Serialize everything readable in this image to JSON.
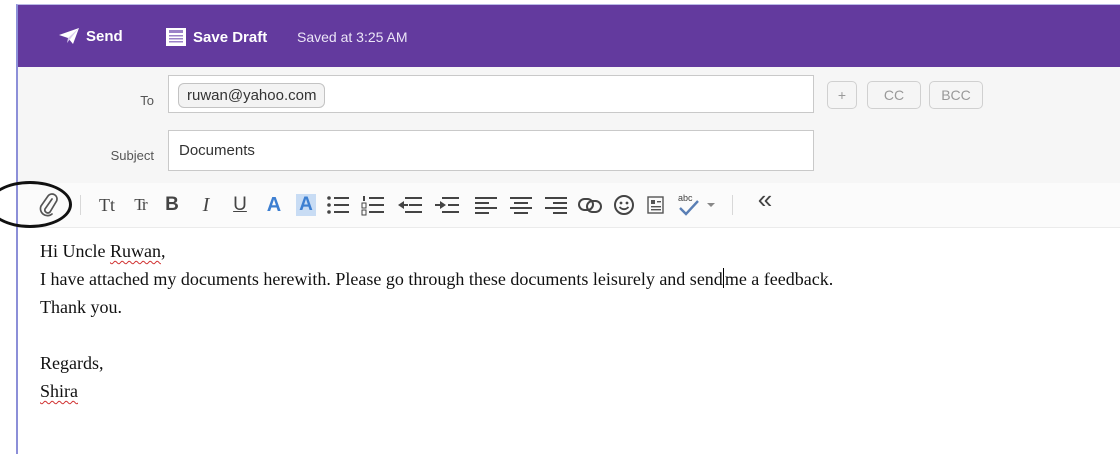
{
  "topbar": {
    "send_label": "Send",
    "save_draft_label": "Save Draft",
    "saved_status": "Saved at 3:25 AM"
  },
  "compose": {
    "to_label": "To",
    "recipients": [
      "ruwan@yahoo.com"
    ],
    "add_recipient": "+",
    "cc_label": "CC",
    "bcc_label": "BCC",
    "subject_label": "Subject",
    "subject_value": "Documents"
  },
  "toolbar": {
    "icons": [
      "attach-icon",
      "font-size-icon",
      "font-format-icon",
      "bold-icon",
      "italic-icon",
      "underline-icon",
      "text-color-icon",
      "highlight-icon",
      "bullet-list-icon",
      "numbered-list-icon",
      "outdent-icon",
      "indent-icon",
      "align-left-icon",
      "align-center-icon",
      "align-right-icon",
      "link-icon",
      "emoji-icon",
      "insert-table-icon",
      "spellcheck-icon",
      "dropdown-arrow-icon",
      "collapse-toolbar-icon"
    ],
    "bold_glyph": "B",
    "italic_glyph": "I",
    "underline_glyph": "U",
    "text_color_glyph": "A",
    "highlight_glyph": "A",
    "font_size_glyph": "Tt",
    "font_format_glyph": "Tr",
    "spell_glyph": "abc",
    "collapse_glyph": "«"
  },
  "message": {
    "greeting_prefix": "Hi Uncle ",
    "greeting_name": "Ruwan",
    "greeting_suffix": ",",
    "line2_before_caret": "I have attached my documents herewith. Please go through these documents leisurely and send",
    "line2_after_caret": "me a feedback.",
    "line3": "Thank you.",
    "closing": "Regards,",
    "signature": "Shira"
  },
  "colors": {
    "topbar": "#633a9e",
    "accent_blue": "#3d7fd1",
    "highlight_bg": "#c8dcf4"
  }
}
